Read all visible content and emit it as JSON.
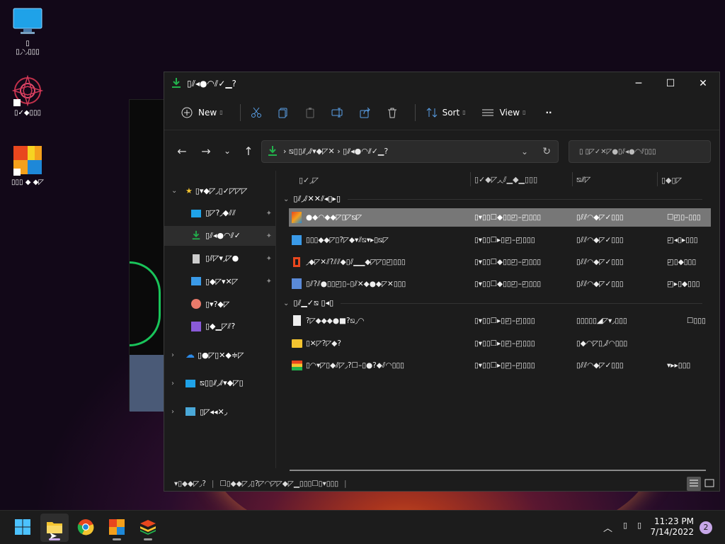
{
  "desktop": {
    "icons": [
      {
        "label": "▯\n▯◞◝◞▯▯▯",
        "icon": "monitor-icon"
      },
      {
        "label": "▯✓◆▯▯▯",
        "icon": "mandala-app-icon"
      },
      {
        "label": "▯▯▯ ◆ ◆◸",
        "icon": "colorful-app-icon"
      }
    ]
  },
  "window": {
    "title": "▯⫽◂●◠⫽✓▁?",
    "controls": {
      "minimize": "─",
      "maximize": "☐",
      "close": "✕"
    }
  },
  "toolbar": {
    "new_label": "New",
    "sort_label": "Sort",
    "view_label": "View",
    "more_label": "··"
  },
  "navigation": {
    "address_text": "›  ⧅▯▯⫽◞⫽▾◆◸✕  › ▯⫽◂●◠⫽✓▁?",
    "search_placeholder": "▯ ▯◸✓✕◸●▯⫽◂●◠⫽▯▯▯"
  },
  "sidebar": {
    "items": [
      {
        "label": "▯▾◆◸◞▯✓◸◸◸",
        "icon": "star-icon"
      },
      {
        "label": "▯◸?◞◆⫽⫽",
        "icon": "desktop-folder-icon"
      },
      {
        "label": "▯⫽◂●◠⫽✓",
        "icon": "download-icon"
      },
      {
        "label": "▯⫽◸▾◞◸●",
        "icon": "document-icon"
      },
      {
        "label": "▯◆◸▾✕◸",
        "icon": "pictures-icon"
      },
      {
        "label": "▯▾?◆◸",
        "icon": "music-icon"
      },
      {
        "label": "▯◆▁◸⫽?",
        "icon": "videos-icon"
      },
      {
        "label": "▯●◸▯✕◆≑◸",
        "icon": "onedrive-icon"
      },
      {
        "label": "⧅▯▯⫽◞⫽▾◆◸▯",
        "icon": "this-pc-icon"
      },
      {
        "label": "▯◸◂◂✕◞",
        "icon": "network-icon"
      }
    ]
  },
  "columns": {
    "name": "▯✓◞◸",
    "date": "▯✓◆◸◞◟⫽▁◆▁▯▯▯",
    "type": "⧅⫽◸",
    "size": "▯◆▯◸"
  },
  "groups": [
    {
      "label": "▯⫽◞⫽✕✕⫽◂▯▸▯"
    },
    {
      "label": "▯⫽▁✓⧅ ▯◂▯"
    }
  ],
  "files": [
    {
      "name": "●◆◠◆◆◸▯◸⧅◸",
      "date": "▯▾▯▯☐◆▯▯◰–◰▯▯▯",
      "type": "▯⫽⫽◠◆◸✓▯▯▯",
      "size": "☐◰▯–▯▯▯",
      "icon": "installer-icon",
      "selected": true
    },
    {
      "name": "▯▯▯◆◆◸▯?◸◆▾⫽⧅▾▸▯⧅◸",
      "date": "▯▾▯▯☐▸▯◰–◰▯▯▯",
      "type": "▯⫽⫽◠◆◸✓▯▯▯",
      "size": "◰◂▯▸▯▯▯",
      "icon": "setup-icon",
      "selected": false
    },
    {
      "name": "◞◆◸✕⫽?⫽⫽◆▯⫽▁▁◆◸◸▯◰▯▯▯",
      "date": "▯▾▯▯☐◆▯▯◰–◰▯▯▯",
      "type": "▯⫽⫽◠◆◸✓▯▯▯",
      "size": "◰▯◆▯▯▯",
      "icon": "office-icon",
      "selected": false
    },
    {
      "name": "▯⫽?⫽●▯▯◰▯–▯⫽✕◆●◆◸✕▯▯▯",
      "date": "▯▾▯▯☐◆▯▯◰–◰▯▯▯",
      "type": "▯⫽⫽◠◆◸✓▯▯▯",
      "size": "◰▸▯◆▯▯▯",
      "icon": "tool-icon",
      "selected": false
    },
    {
      "name": "?◸◆◆◆●■?⧅◞◠",
      "date": "▯▾▯▯☐▸▯◰–◰▯▯▯",
      "type": "▯▯▯▯▯◢◸▾◞▯▯▯",
      "size": "☐▯▯▯",
      "icon": "text-file-icon",
      "selected": false
    },
    {
      "name": "▯✕◸?◸◆?",
      "date": "▯▾▯▯☐▸▯◰–◰▯▯▯",
      "type": "▯◆◠◸▯◞⫽◠▯▯▯",
      "size": "",
      "icon": "folder-icon",
      "selected": false
    },
    {
      "name": "▯◠▾◸▯◆⫽◸◞?☐–▯●?◆⫽◠▯▯▯",
      "date": "▯▾▯▯☐▸▯◰–◰▯▯▯",
      "type": "▯⫽⫽◠◆◸✓▯▯▯",
      "size": "▾▸▸▯▯▯",
      "icon": "stack-app-icon",
      "selected": false
    }
  ],
  "status": {
    "count": "▾▯◆◆◸◞?",
    "selection": "☐▯◆◆◸◞▯?◸◠◸◸◆◸▁▯▯▯☐▯▾▯▯▯"
  },
  "taskbar": {
    "time": "11:23 PM",
    "date": "7/14/2022",
    "notification_count": "2"
  }
}
